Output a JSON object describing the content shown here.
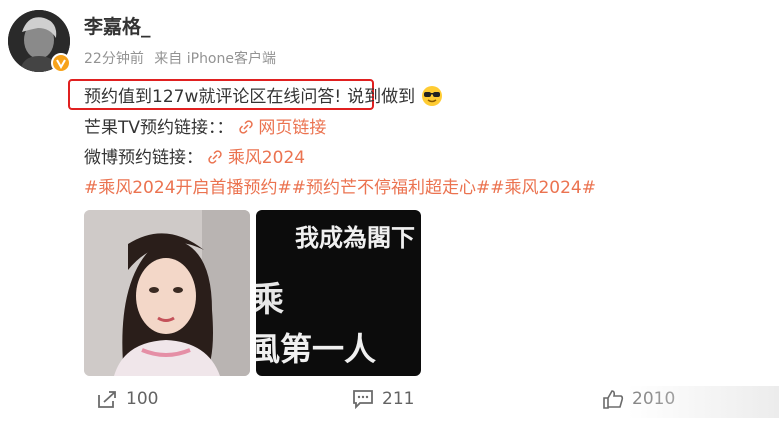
{
  "post": {
    "author": "李嘉格_",
    "time": "22分钟前",
    "source": "来自 iPhone客户端",
    "line1_highlight": "预约值到127w就评论区在线问答!",
    "line1_rest": "说到做到",
    "line2_label": "芒果TV预约链接：：",
    "line2_link": "网页链接",
    "line3_label": "微博预约链接：",
    "line3_link": "乘风2024",
    "hashtags": "#乘风2024开启首播预约##预约芒不停福利超走心##乘风2024#",
    "image2_text_top": "我成為閣下",
    "image2_text_mid": "乘",
    "image2_text_bottom": "風第一人"
  },
  "footer": {
    "share_count": "100",
    "comment_count": "211",
    "like_count": "2010"
  },
  "colors": {
    "link": "#eb7350",
    "highlight_border": "#e02020",
    "badge": "#f7a21a"
  }
}
